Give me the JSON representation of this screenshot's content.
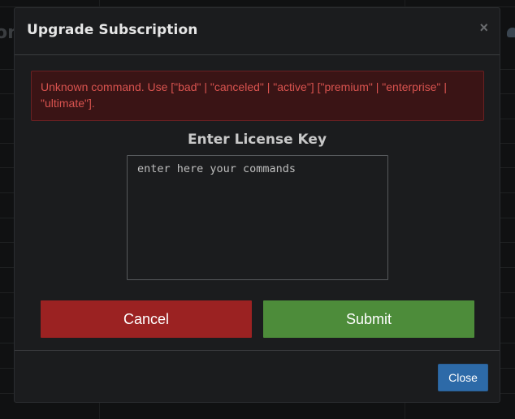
{
  "background": {
    "partial_title": "on"
  },
  "modal": {
    "title": "Upgrade Subscription",
    "close_glyph": "×",
    "alert_text": "Unknown command. Use [\"bad\" | \"canceled\" | \"active\"] [\"premium\" | \"enterprise\" | \"ultimate\"].",
    "license_heading": "Enter License Key",
    "textarea_placeholder": "enter here your commands",
    "textarea_value": "",
    "cancel_label": "Cancel",
    "submit_label": "Submit",
    "footer_close_label": "Close"
  },
  "colors": {
    "alert_text": "#d9534f",
    "alert_bg": "#3a1415",
    "cancel_bg": "#9b2222",
    "submit_bg": "#4d8c3a",
    "close_bg": "#2d6aa8",
    "modal_bg": "#1b1c1e"
  },
  "icons": {
    "header_close": "close-icon",
    "background_cloud": "cloud-icon"
  }
}
